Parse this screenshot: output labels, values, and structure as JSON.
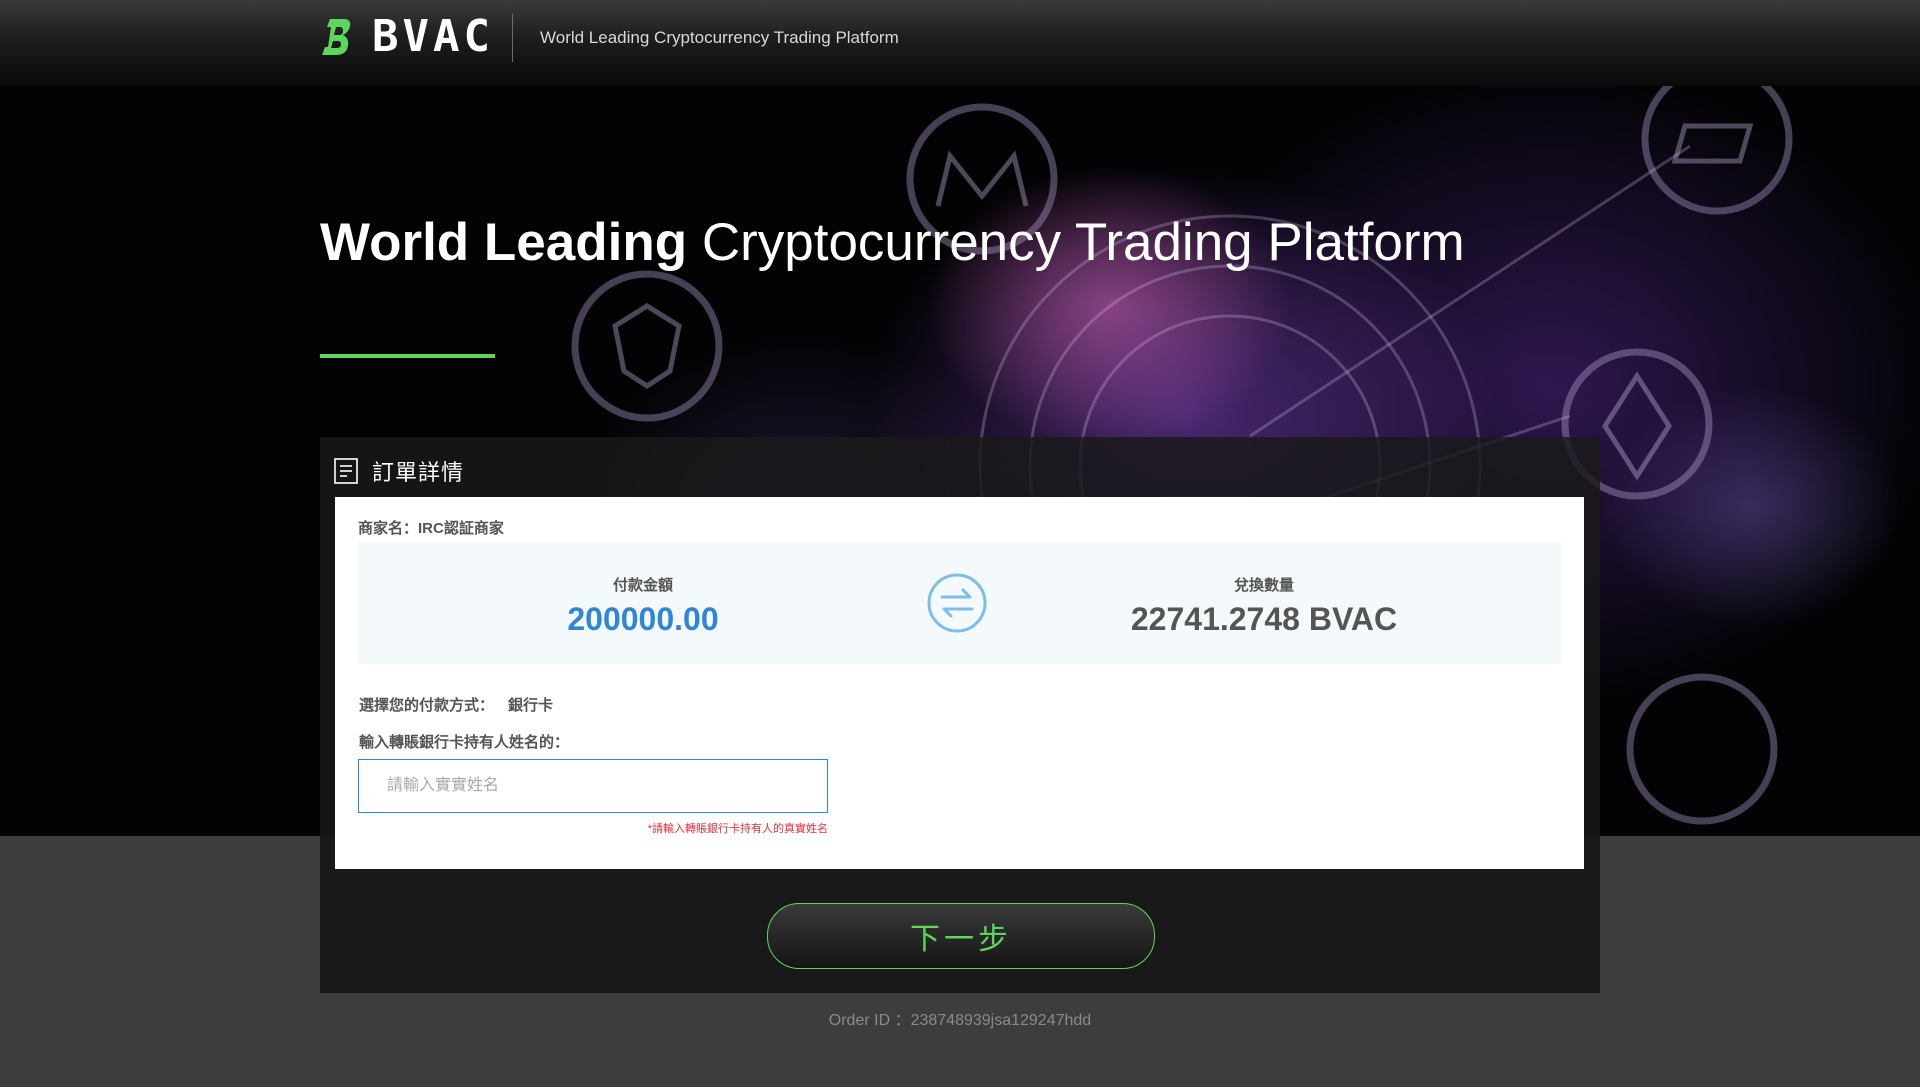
{
  "header": {
    "logo_text": "BVAC",
    "tagline": "World Leading Cryptocurrency Trading Platform"
  },
  "hero": {
    "title_bold": "World Leading",
    "title_rest": "Cryptocurrency Trading Platform"
  },
  "order": {
    "panel_title": "訂單詳情",
    "merchant": "商家名：IRC認証商家",
    "payment_amount_label": "付款金額",
    "payment_amount": "200000.00",
    "exchange_qty_label": "兌換數量",
    "exchange_qty": "22741.2748 BVAC",
    "pay_method_label": "選擇您的付款方式：",
    "pay_method_value": "銀行卡",
    "holder_name_label": "輸入轉賬銀行卡持有人姓名的：",
    "holder_name_placeholder": "請輸入實實姓名",
    "holder_name_value": "",
    "holder_name_hint": "*請輸入轉賬銀行卡持有人的真實姓名",
    "next_button": "下一步",
    "order_id": "Order ID ：238748939jsa129247hdd"
  },
  "colors": {
    "accent_green": "#5cd65c",
    "amount_blue": "#2f86d6",
    "hint_red": "#e0303b"
  },
  "icons": {
    "logo": "bvac-logo-icon",
    "panel": "document-icon",
    "swap": "swap-arrows-icon"
  }
}
